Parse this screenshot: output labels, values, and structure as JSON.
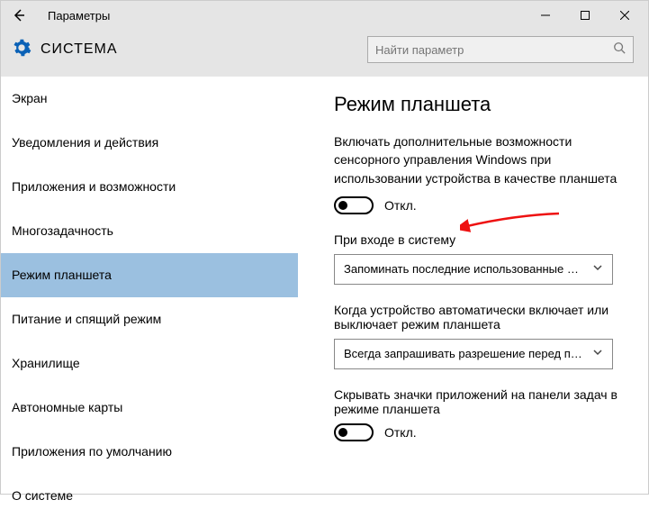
{
  "window": {
    "title": "Параметры"
  },
  "header": {
    "system_label": "СИСТЕМА",
    "search_placeholder": "Найти параметр"
  },
  "sidebar": {
    "items": [
      {
        "label": "Экран"
      },
      {
        "label": "Уведомления и действия"
      },
      {
        "label": "Приложения и возможности"
      },
      {
        "label": "Многозадачность"
      },
      {
        "label": "Режим планшета"
      },
      {
        "label": "Питание и спящий режим"
      },
      {
        "label": "Хранилище"
      },
      {
        "label": "Автономные карты"
      },
      {
        "label": "Приложения по умолчанию"
      },
      {
        "label": "О системе"
      }
    ],
    "selected_index": 4
  },
  "panel": {
    "heading": "Режим планшета",
    "desc1": "Включать дополнительные возможности сенсорного управления Windows при использовании устройства в качестве планшета",
    "toggle1_state": "Откл.",
    "label2": "При входе в систему",
    "select2_value": "Запоминать последние использованные д…",
    "label3": "Когда устройство автоматически включает или выключает режим планшета",
    "select3_value": "Всегда запрашивать разрешение перед пе…",
    "label4": "Скрывать значки приложений на панели задач в режиме планшета",
    "toggle4_state": "Откл."
  },
  "annotation": {
    "arrow_color": "#e11"
  }
}
